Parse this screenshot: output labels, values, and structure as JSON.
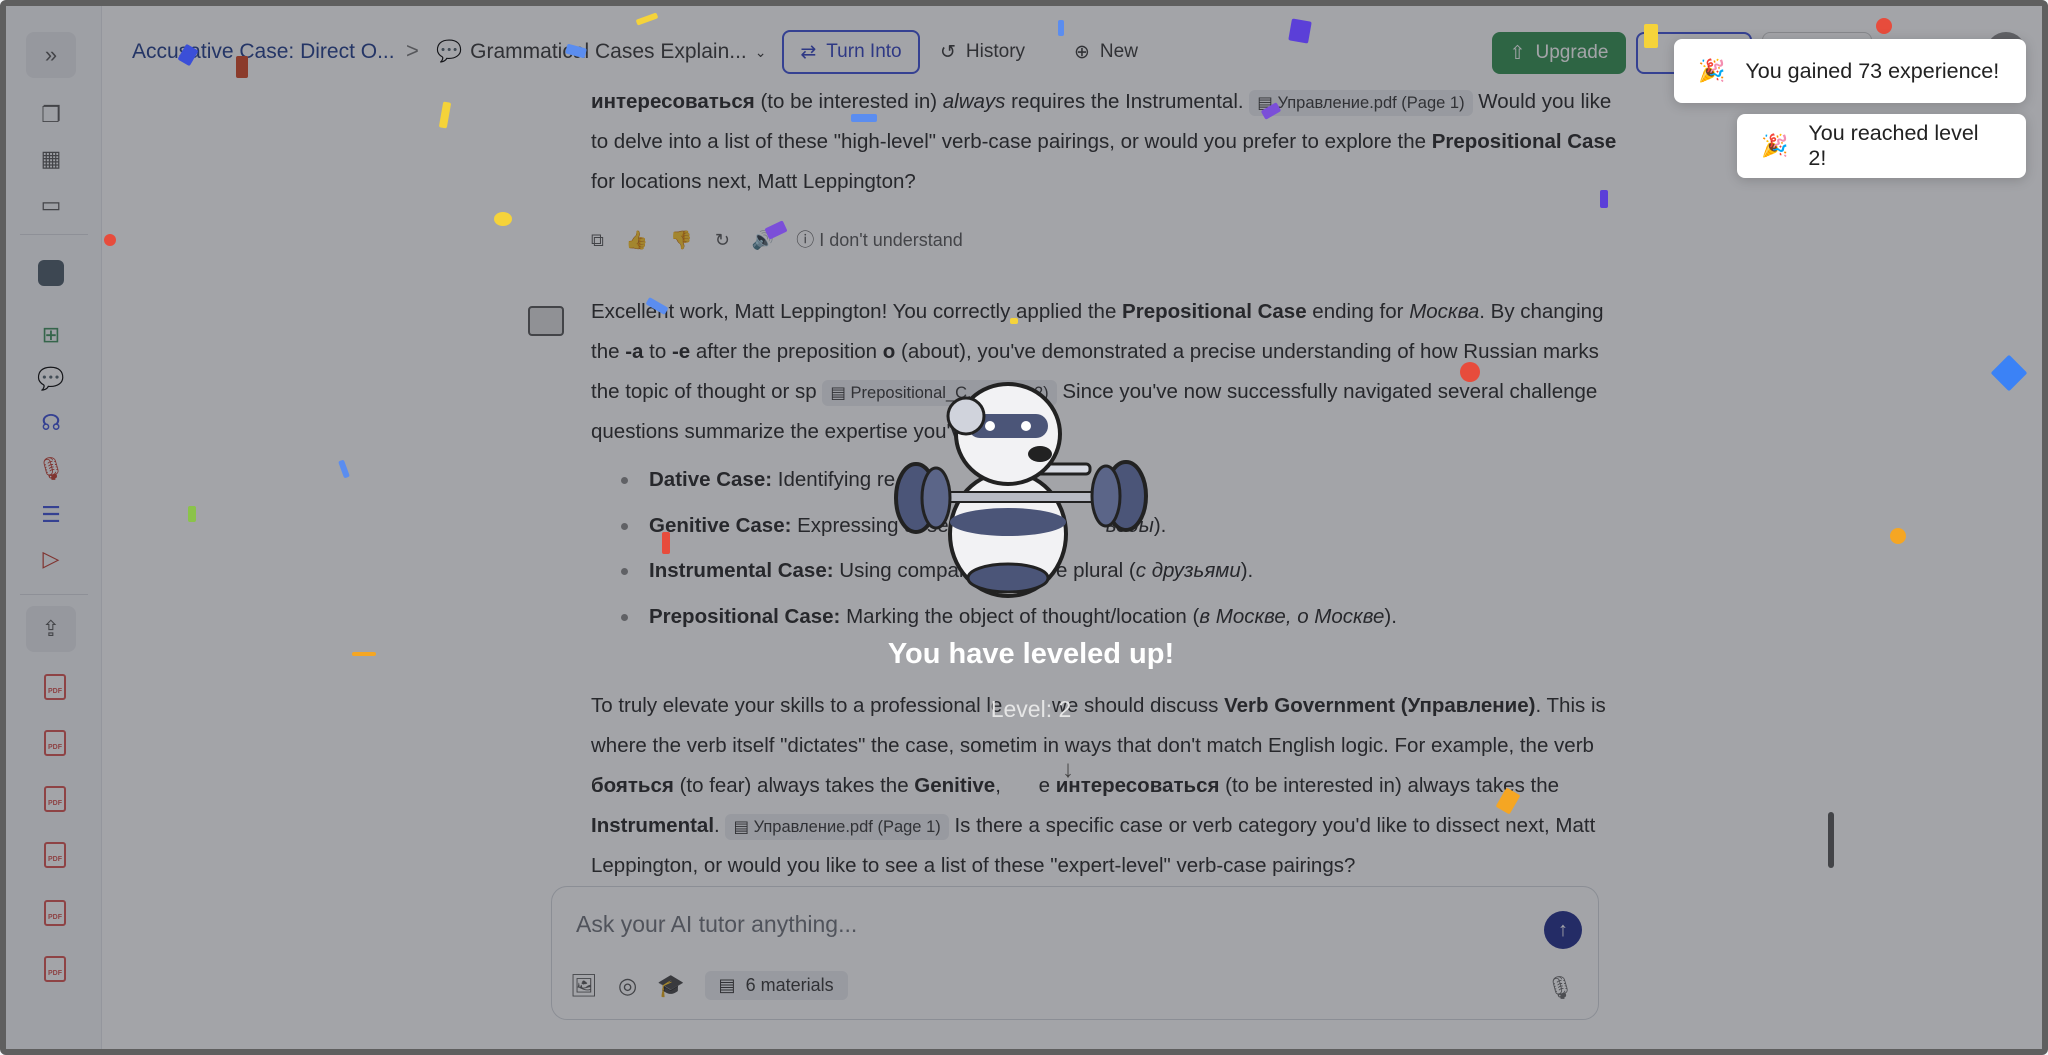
{
  "breadcrumb": {
    "item1": "Accusative Case: Direct O...",
    "separator": ">",
    "item2": "Grammatical Cases Explain..."
  },
  "toolbar": {
    "turn_into": "Turn Into",
    "history": "History",
    "new": "New",
    "upgrade": "Upgrade"
  },
  "messages": {
    "msg1": {
      "part1": "интересоваться",
      "part2": " (to be interested in) ",
      "part3": "always",
      "part4": " requires the Instrumental. ",
      "cite": "Управление.pdf (Page 1)",
      "part5": " Would you like to delve into a list of these \"high-level\" verb-case pairings, or would you prefer to explore the ",
      "part6": "Prepositional Case",
      "part7": " for locations next, Matt Leppington?"
    },
    "actions": {
      "dont_understand": "I don't understand"
    },
    "msg2": {
      "a1": "Excellent work, Matt Leppington! You correctly applied the ",
      "a2": "Prepositional Case",
      "a3": " ending for ",
      "a4": "Москва",
      "a5": ". By changing the ",
      "a6": "-а",
      "a7": " to ",
      "a8": "-е",
      "a9": " after the preposition ",
      "a10": "о",
      "a11": " (about), you've demonstrated a precise understanding of how Russian marks the topic of thought or sp",
      "cite": "Prepositional_C... (Page 2)",
      "a12": " Since you've now successfully navigated several challenge questions",
      "a13": " summarize the expertise you've shown:"
    },
    "bullets": [
      {
        "label": "Dative Case:",
        "text": " Identifying re"
      },
      {
        "label": "Genitive Case:",
        "text": " Expressing absen",
        "italic": "воды",
        "tail": ")."
      },
      {
        "label": "Instrumental Case:",
        "text": " Using compan",
        "text2": " e plural (",
        "italic": "с друзьями",
        "tail": ")."
      },
      {
        "label": "Prepositional Case:",
        "text": " Marking the object of thought/location (",
        "italic": "в Москве, о Москве",
        "tail": ")."
      }
    ],
    "msg3": {
      "b1": "To truly elevate your skills to a professional le",
      "b2": " we should discuss ",
      "b3": "Verb Government (Управление)",
      "b4": ". This is where the verb itself \"dictates\" the case, sometim",
      "b5": " in ways that don't match English logic. For example, the verb ",
      "b6": "бояться",
      "b7": " (to fear) always takes the ",
      "b8": "Genitive",
      "b9": ", ",
      "b10": "e ",
      "b11": "интересоваться",
      "b12": " (to be interested in) always takes the ",
      "b13": "Instrumental",
      "b14": ". ",
      "cite": "Управление.pdf (Page 1)",
      "b15": " Is there a specific case or verb category you'd like to dissect next, Matt Leppington, or would you like to see a list of these \"expert-level\" verb-case pairings?"
    }
  },
  "input": {
    "placeholder": "Ask your AI tutor anything...",
    "materials": "6 materials"
  },
  "levelup": {
    "title": "You have leveled up!",
    "level": "Level: 2"
  },
  "toasts": [
    {
      "text": "You gained 73 experience!"
    },
    {
      "text": "You reached level 2!"
    }
  ],
  "colors": {
    "accent": "#3b4fd8",
    "upgrade": "#2f8f4e",
    "send": "#1e2a8a"
  }
}
